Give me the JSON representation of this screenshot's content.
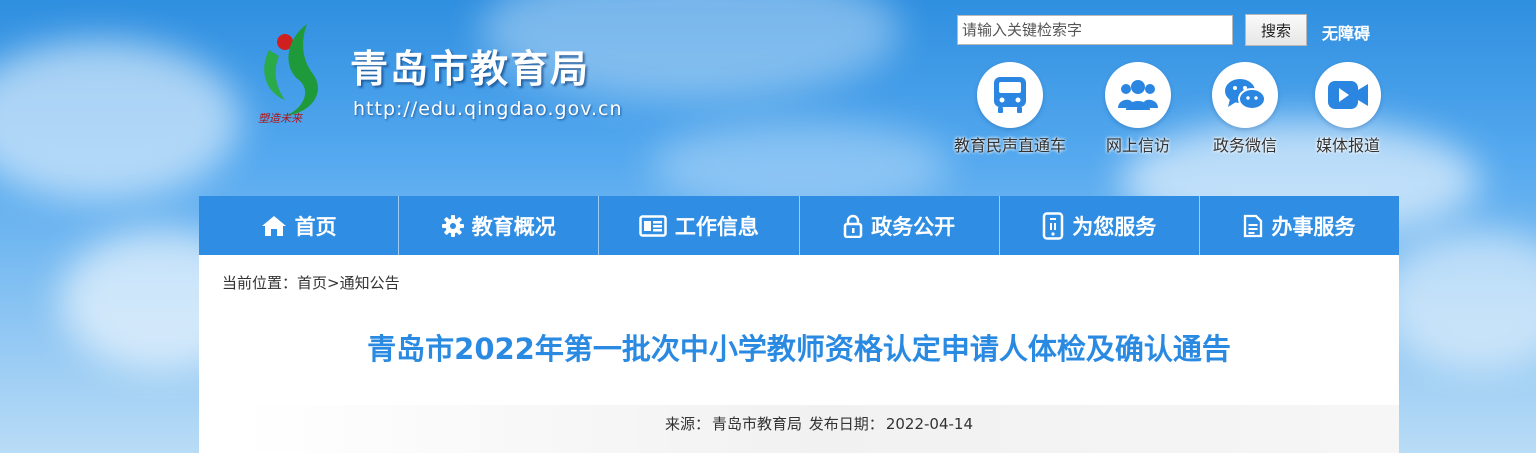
{
  "header": {
    "site_title": "青岛市教育局",
    "site_url": "http://edu.qingdao.gov.cn",
    "logo_motto": "塑造未来",
    "search_placeholder": "请输入关键检索字",
    "search_button": "搜索",
    "accessibility": "无障碍"
  },
  "quick_links": [
    {
      "label": "教育民声直通车",
      "icon": "bus-icon"
    },
    {
      "label": "网上信访",
      "icon": "users-icon"
    },
    {
      "label": "政务微信",
      "icon": "wechat-icon"
    },
    {
      "label": "媒体报道",
      "icon": "video-icon"
    }
  ],
  "nav": [
    {
      "label": "首页",
      "icon": "home-icon"
    },
    {
      "label": "教育概况",
      "icon": "gear-icon"
    },
    {
      "label": "工作信息",
      "icon": "news-icon"
    },
    {
      "label": "政务公开",
      "icon": "lock-icon"
    },
    {
      "label": "为您服务",
      "icon": "phone-icon"
    },
    {
      "label": "办事服务",
      "icon": "document-icon"
    }
  ],
  "breadcrumb": {
    "prefix": "当前位置：",
    "home": "首页",
    "separator": ">",
    "current": "通知公告"
  },
  "article": {
    "title": "青岛市2022年第一批次中小学教师资格认定申请人体检及确认通告",
    "source_label": "来源：",
    "source": "青岛市教育局",
    "date_label": "发布日期：",
    "date": "2022-04-14"
  },
  "colors": {
    "nav_bg": "#2f8ee4",
    "title_blue": "#2a8ae2",
    "icon_blue": "#2a86e0",
    "logo_green": "#1f9a3a",
    "logo_red": "#d11f1f"
  }
}
